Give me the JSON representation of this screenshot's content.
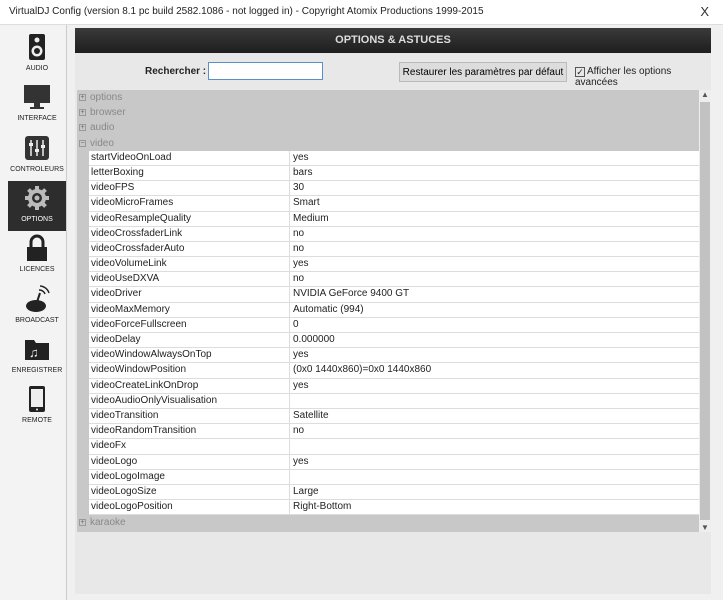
{
  "window": {
    "title": "VirtualDJ Config (version 8.1 pc build 2582.1086 - not logged in) - Copyright Atomix Productions 1999-2015",
    "close": "X"
  },
  "sidebar": [
    {
      "label": "AUDIO",
      "icon": "speaker-icon"
    },
    {
      "label": "INTERFACE",
      "icon": "monitor-icon"
    },
    {
      "label": "CONTROLEURS",
      "icon": "mixer-icon"
    },
    {
      "label": "OPTIONS",
      "icon": "gear-icon"
    },
    {
      "label": "LICENCES",
      "icon": "lock-icon"
    },
    {
      "label": "BROADCAST",
      "icon": "antenna-icon"
    },
    {
      "label": "ENREGISTRER",
      "icon": "music-folder-icon"
    },
    {
      "label": "REMOTE",
      "icon": "tablet-icon"
    }
  ],
  "header": {
    "title": "OPTIONS & ASTUCES"
  },
  "search": {
    "label": "Rechercher :",
    "value": ""
  },
  "restore_label": "Restaurer les paramètres par défaut",
  "advanced": {
    "label": "Afficher les options avancées",
    "checked": true
  },
  "categories_top": [
    "options",
    "browser",
    "audio",
    "video"
  ],
  "rows": [
    [
      "startVideoOnLoad",
      "yes"
    ],
    [
      "letterBoxing",
      "bars"
    ],
    [
      "videoFPS",
      "30"
    ],
    [
      "videoMicroFrames",
      "Smart"
    ],
    [
      "videoResampleQuality",
      "Medium"
    ],
    [
      "videoCrossfaderLink",
      "no"
    ],
    [
      "videoCrossfaderAuto",
      "no"
    ],
    [
      "videoVolumeLink",
      "yes"
    ],
    [
      "videoUseDXVA",
      "no"
    ],
    [
      "videoDriver",
      "NVIDIA GeForce 9400 GT"
    ],
    [
      "videoMaxMemory",
      "Automatic (994)"
    ],
    [
      "videoForceFullscreen",
      "0"
    ],
    [
      "videoDelay",
      "0.000000"
    ],
    [
      "videoWindowAlwaysOnTop",
      "yes"
    ],
    [
      "videoWindowPosition",
      "(0x0 1440x860)=0x0 1440x860"
    ],
    [
      "videoCreateLinkOnDrop",
      "yes"
    ],
    [
      "videoAudioOnlyVisualisation",
      ""
    ],
    [
      "videoTransition",
      "Satellite"
    ],
    [
      "videoRandomTransition",
      "no"
    ],
    [
      "videoFx",
      ""
    ],
    [
      "videoLogo",
      "yes"
    ],
    [
      "videoLogoImage",
      ""
    ],
    [
      "videoLogoSize",
      "Large"
    ],
    [
      "videoLogoPosition",
      "Right-Bottom"
    ]
  ],
  "category_bottom": "karaoke"
}
